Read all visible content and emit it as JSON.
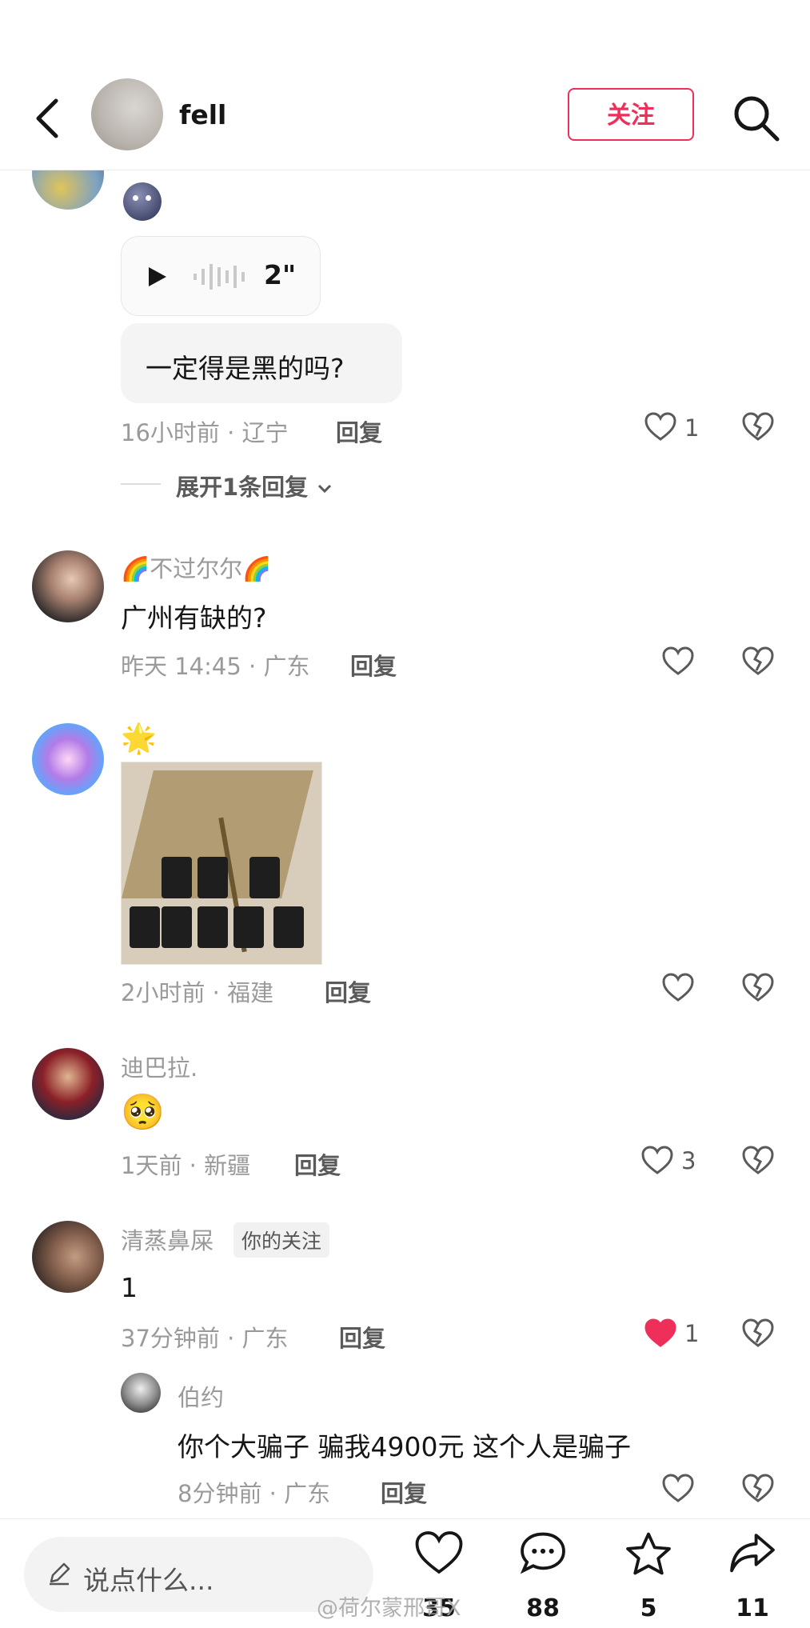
{
  "header": {
    "username": "fell",
    "follow_label": "关注"
  },
  "thread1": {
    "voice_duration": "2\"",
    "bubble_text": "一定得是黑的吗?",
    "meta": "16小时前 · 辽宁",
    "reply_label": "回复",
    "like_count": "1",
    "expand_label": "展开1条回复"
  },
  "comments": [
    {
      "name": "🌈不过尔尔🌈",
      "text": "广州有缺的?",
      "meta": "昨天 14:45 · 广东",
      "reply_label": "回复",
      "like_count": ""
    },
    {
      "name": "🌟",
      "meta": "2小时前 · 福建",
      "reply_label": "回复",
      "like_count": ""
    },
    {
      "name": "迪巴拉.",
      "emoji": "🥺",
      "meta": "1天前 · 新疆",
      "reply_label": "回复",
      "like_count": "3"
    },
    {
      "name": "清蒸鼻屎",
      "tag": "你的关注",
      "text": "1",
      "meta": "37分钟前 · 广东",
      "reply_label": "回复",
      "like_count": "1",
      "liked": true
    }
  ],
  "reply": {
    "name": "伯约",
    "text": "你个大骗子 骗我4900元 这个人是骗子",
    "meta": "8分钟前 · 广东",
    "reply_label": "回复"
  },
  "bottom": {
    "input_placeholder": "说点什么...",
    "likes": "35",
    "comments": "88",
    "favorites": "5",
    "shares": "11"
  },
  "watermark": "@荷尔蒙邢哥X",
  "colors": {
    "accent": "#ee2f5a",
    "text": "#161616",
    "meta": "#9a9a9a"
  }
}
